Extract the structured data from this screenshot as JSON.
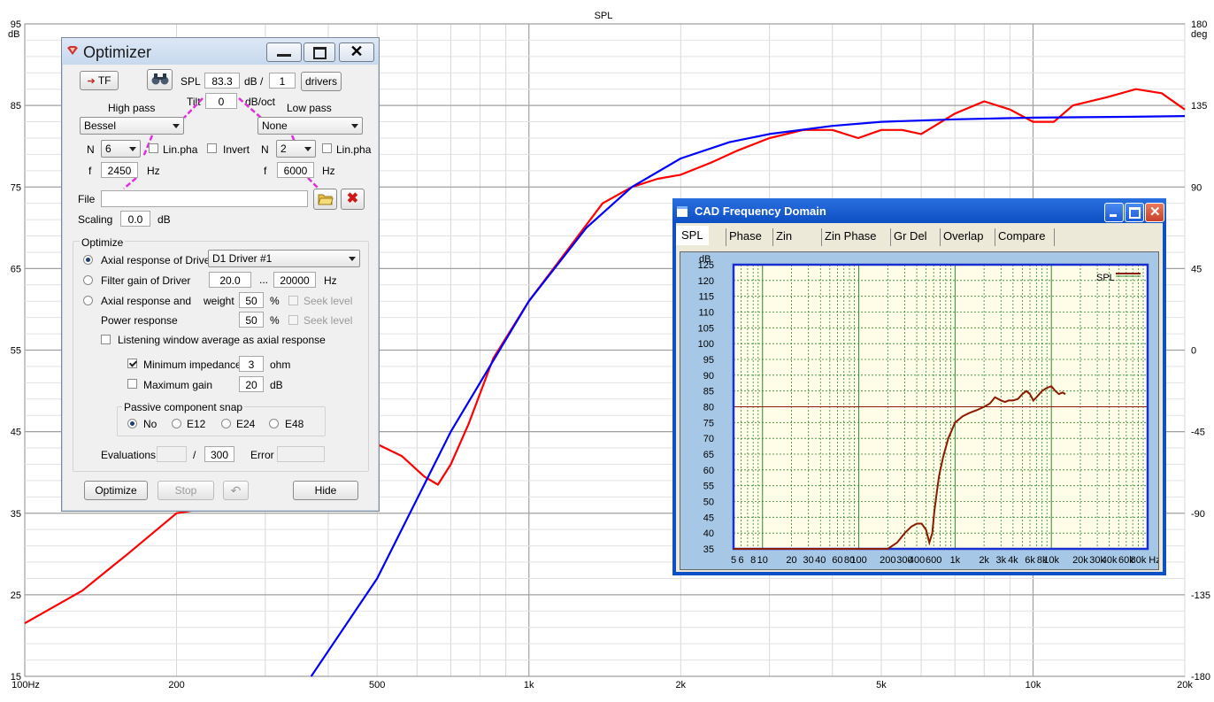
{
  "main_chart": {
    "title": "SPL",
    "y_unit_left": "dB",
    "y_unit_right": "deg",
    "left_ticks": [
      "95",
      "85",
      "75",
      "65",
      "55",
      "45",
      "35",
      "25",
      "15"
    ],
    "right_ticks": [
      "180",
      "135",
      "90",
      "45",
      "0",
      "-45",
      "-90",
      "-135",
      "-180"
    ],
    "x_ticks": [
      "100Hz",
      "200",
      "500",
      "1k",
      "2k",
      "5k",
      "10k",
      "20k"
    ]
  },
  "chart_data": {
    "type": "line",
    "title": "SPL",
    "xlabel": "",
    "ylabel": "dB",
    "x_scale": "log",
    "xlim": [
      100,
      20000
    ],
    "ylim": [
      15,
      95
    ],
    "y2lim": [
      -180,
      180
    ],
    "y2label": "deg",
    "grid": true,
    "series": [
      {
        "color": "#ff0000",
        "x": [
          100,
          130,
          160,
          200,
          250,
          320,
          400,
          480,
          560,
          620,
          660,
          700,
          760,
          850,
          1000,
          1200,
          1400,
          1600,
          1800,
          2000,
          2300,
          2600,
          3000,
          3500,
          4000,
          4500,
          5000,
          5500,
          6000,
          7000,
          8000,
          9000,
          10000,
          11000,
          12000,
          14000,
          16000,
          18000,
          20000
        ],
        "y": [
          21.5,
          25.5,
          30,
          35,
          36,
          40,
          43,
          44,
          42,
          39.5,
          38.5,
          41,
          46,
          54,
          61,
          67.5,
          73,
          75,
          76,
          76.5,
          78,
          79.5,
          81,
          82,
          82,
          81,
          82,
          82,
          81.5,
          84,
          85.5,
          84.5,
          83,
          83,
          85,
          86,
          87,
          86.5,
          84.5
        ]
      },
      {
        "color": "#0000ff",
        "x": [
          370,
          500,
          700,
          1000,
          1300,
          1600,
          2000,
          2500,
          3000,
          4000,
          5000,
          7000,
          10000,
          15000,
          20000
        ],
        "y": [
          15,
          27,
          45,
          61,
          70,
          75,
          78.5,
          80.5,
          81.5,
          82.5,
          83,
          83.3,
          83.5,
          83.6,
          83.7
        ]
      }
    ]
  },
  "optimizer": {
    "title": "Optimizer",
    "tf_label": "TF",
    "spl_label": "SPL",
    "spl_value": "83.3",
    "db_slash": "dB /",
    "drivers_count": "1",
    "drivers_label": "drivers",
    "tilt_label": "Tilt",
    "tilt_value": "0",
    "dboct_label": "dB/oct",
    "high_pass_label": "High pass",
    "low_pass_label": "Low pass",
    "hp_type": "Bessel",
    "lp_type": "None",
    "n_label": "N",
    "hp_n": "6",
    "lp_n": "2",
    "linpha_label": "Lin.pha",
    "invert_label": "Invert",
    "f_label": "f",
    "hp_f": "2450",
    "lp_f": "6000",
    "hz_label": "Hz",
    "file_label": "File",
    "file_value": "",
    "scaling_label": "Scaling",
    "scaling_value": "0.0",
    "db_label": "dB",
    "optimize_group": "Optimize",
    "axial_label": "Axial response of Driver",
    "driver_select": "D1 Driver #1",
    "filter_gain_label": "Filter gain of Driver",
    "fg_from": "20.0",
    "ellipsis": "...",
    "fg_to": "20000",
    "axial_power_label": "Axial response and",
    "weight_label": "weight",
    "weight1": "50",
    "weight2": "50",
    "percent": "%",
    "seek_level": "Seek level",
    "power_label": "Power response",
    "listening_label": "Listening window average as axial response",
    "min_imp_label": "Minimum impedance",
    "min_imp_value": "3",
    "ohm_label": "ohm",
    "max_gain_label": "Maximum gain",
    "max_gain_value": "20",
    "snap_group": "Passive component snap",
    "snap_no": "No",
    "snap_e12": "E12",
    "snap_e24": "E24",
    "snap_e48": "E48",
    "evaluations_label": "Evaluations",
    "eval_slash": "/",
    "eval_max": "300",
    "error_label": "Error",
    "optimize_btn": "Optimize",
    "stop_btn": "Stop",
    "hide_btn": "Hide"
  },
  "cad": {
    "title": "CAD Frequency Domain",
    "tabs": [
      "SPL",
      "Phase",
      "Zin",
      "Zin Phase",
      "Gr Del",
      "Overlap",
      "Compare"
    ],
    "y_unit": "dB",
    "y_ticks": [
      "125",
      "120",
      "115",
      "110",
      "105",
      "100",
      "95",
      "90",
      "85",
      "80",
      "75",
      "70",
      "65",
      "60",
      "55",
      "50",
      "45",
      "40",
      "35"
    ],
    "x_ticks": [
      "5",
      "6",
      "8",
      "10",
      "20",
      "30",
      "40",
      "60",
      "80",
      "100",
      "200",
      "300",
      "400",
      "600",
      "1k",
      "2k",
      "3k",
      "4k",
      "6k",
      "8k",
      "10k",
      "20k",
      "30k",
      "40k",
      "60k",
      "80k",
      "Hz"
    ],
    "legend": "SPL"
  },
  "cad_chart_data": {
    "type": "line",
    "x_scale": "log",
    "xlim": [
      5,
      100000
    ],
    "ylim": [
      35,
      125
    ],
    "reference_level": 80,
    "series": [
      {
        "name": "SPL",
        "color": "#8b1a00",
        "x": [
          5,
          100,
          150,
          200,
          250,
          300,
          350,
          400,
          450,
          500,
          540,
          580,
          610,
          640,
          680,
          750,
          850,
          1000,
          1200,
          1400,
          1700,
          2000,
          2300,
          2600,
          3000,
          3300,
          3600,
          4000,
          4500,
          5000,
          5500,
          6000,
          6500,
          7000,
          8000,
          9000,
          10000,
          11000,
          12000,
          13000,
          14000
        ],
        "y": [
          35,
          35,
          35,
          35,
          37,
          40,
          42,
          43,
          43,
          41,
          37,
          40,
          47,
          52,
          58,
          64,
          70,
          75,
          77,
          78,
          79,
          80,
          81,
          83,
          82,
          81.5,
          82,
          82,
          82.5,
          84,
          85,
          84,
          82,
          83,
          85,
          86,
          86.5,
          85,
          84,
          84.5,
          84
        ]
      }
    ]
  }
}
